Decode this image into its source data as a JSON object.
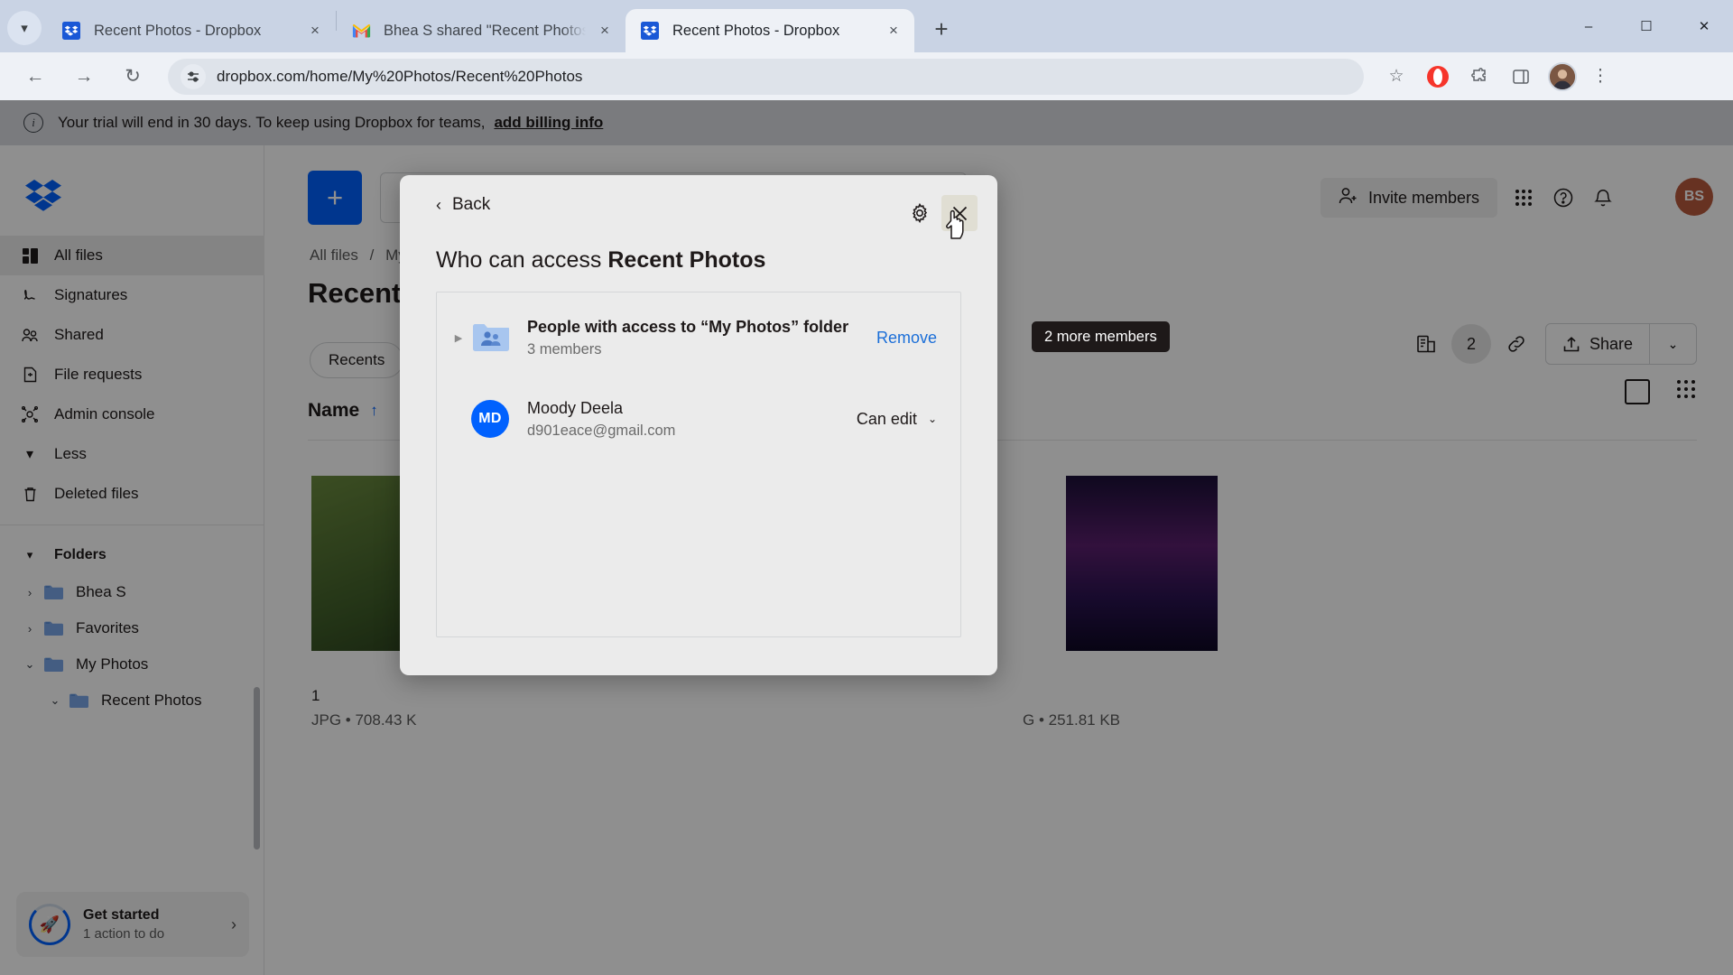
{
  "browser": {
    "tabs": [
      {
        "title": "Recent Photos - Dropbox",
        "favicon": "dropbox-icon",
        "active": false
      },
      {
        "title": "Bhea S shared \"Recent Photos",
        "favicon": "gmail-icon",
        "active": false
      },
      {
        "title": "Recent Photos - Dropbox",
        "favicon": "dropbox-icon",
        "active": true
      }
    ],
    "tab_close_label": "×",
    "new_tab_label": "+",
    "tab_search_icon": "chevron-down-icon",
    "window_controls": {
      "minimize": "–",
      "maximize": "☐",
      "close": "✕"
    },
    "nav": {
      "back": "←",
      "forward": "→",
      "reload": "↻"
    },
    "omnibox": {
      "url": "dropbox.com/home/My%20Photos/Recent%20Photos",
      "site_controls_icon": "site-settings-icon"
    },
    "toolbar_right": {
      "bookmark_icon": "star-icon",
      "extension1_icon": "opera-icon",
      "extension2_icon": "puzzle-icon",
      "sidepanel_icon": "side-panel-icon",
      "menu_icon": "kebab-menu-icon"
    }
  },
  "banner": {
    "icon": "info-icon",
    "text": "Your trial will end in 30 days. To keep using Dropbox for teams,",
    "link": "add billing info"
  },
  "sidebar": {
    "logo": "dropbox-logo",
    "items": [
      {
        "label": "All files",
        "icon": "all-files-icon",
        "selected": true
      },
      {
        "label": "Signatures",
        "icon": "signature-icon",
        "selected": false
      },
      {
        "label": "Shared",
        "icon": "shared-people-icon",
        "selected": false
      },
      {
        "label": "File requests",
        "icon": "file-request-icon",
        "selected": false
      },
      {
        "label": "Admin console",
        "icon": "admin-console-icon",
        "selected": false
      },
      {
        "label": "Less",
        "icon": "chevron-down-icon",
        "selected": false
      },
      {
        "label": "Deleted files",
        "icon": "trash-icon",
        "selected": false
      }
    ],
    "folders_header": {
      "label": "Folders",
      "icon": "chevron-down-icon"
    },
    "folders": [
      {
        "label": "Bhea S",
        "chevron": "›",
        "indent": 0
      },
      {
        "label": "Favorites",
        "chevron": "›",
        "indent": 0
      },
      {
        "label": "My Photos",
        "chevron": "⌄",
        "indent": 0
      },
      {
        "label": "Recent Photos",
        "chevron": "⌄",
        "indent": 1
      }
    ],
    "get_started": {
      "title": "Get started",
      "subtitle": "1 action to do",
      "icon": "rocket-icon",
      "chevron": "›"
    }
  },
  "main": {
    "create_button": "+",
    "invite_members": {
      "label": "Invite members",
      "icon": "person-add-icon"
    },
    "header_icons": {
      "apps": "grid-apps-icon",
      "help": "help-circle-icon",
      "notifications": "bell-icon"
    },
    "user_initials": "BS",
    "breadcrumb": [
      "All files",
      "My"
    ],
    "breadcrumb_separator": "/",
    "page_title": "Recent P",
    "filter_chip": "Recents",
    "column_name": "Name",
    "sort_arrow": "↑",
    "share_tools": {
      "activity_icon": "activity-icon",
      "member_count": "2",
      "link_icon": "link-icon",
      "share_label": "Share",
      "share_caret": "⌄"
    },
    "view_toggle": {
      "list_icon": "list-view-icon",
      "grid_icon": "grid-view-icon"
    },
    "tooltip": "2 more members",
    "files": [
      {
        "name": "1",
        "meta": "JPG • 708.43 K"
      },
      {
        "name": "",
        "meta": "G • 251.81 KB"
      }
    ]
  },
  "modal": {
    "back_label": "Back",
    "back_chevron": "‹",
    "settings_icon": "gear-icon",
    "close_icon": "close-icon",
    "title_prefix": "Who can access ",
    "title_target": "Recent Photos",
    "rows": [
      {
        "type": "group",
        "caret": "▶",
        "avatar_icon": "shared-folder-icon",
        "name": "People with access to “My Photos” folder",
        "sub": "3 members",
        "action": "Remove",
        "action_type": "link"
      },
      {
        "type": "person",
        "initials": "MD",
        "name": "Moody Deela",
        "sub": "d901eace@gmail.com",
        "action": "Can edit",
        "action_type": "perm",
        "action_caret": "⌄"
      }
    ]
  },
  "colors": {
    "dropbox_blue": "#0061fe",
    "link_blue": "#1a6ed8",
    "tab_strip": "#c9d3e4",
    "banner_bg": "#d9dce1",
    "modal_bg": "#ebebeb"
  }
}
